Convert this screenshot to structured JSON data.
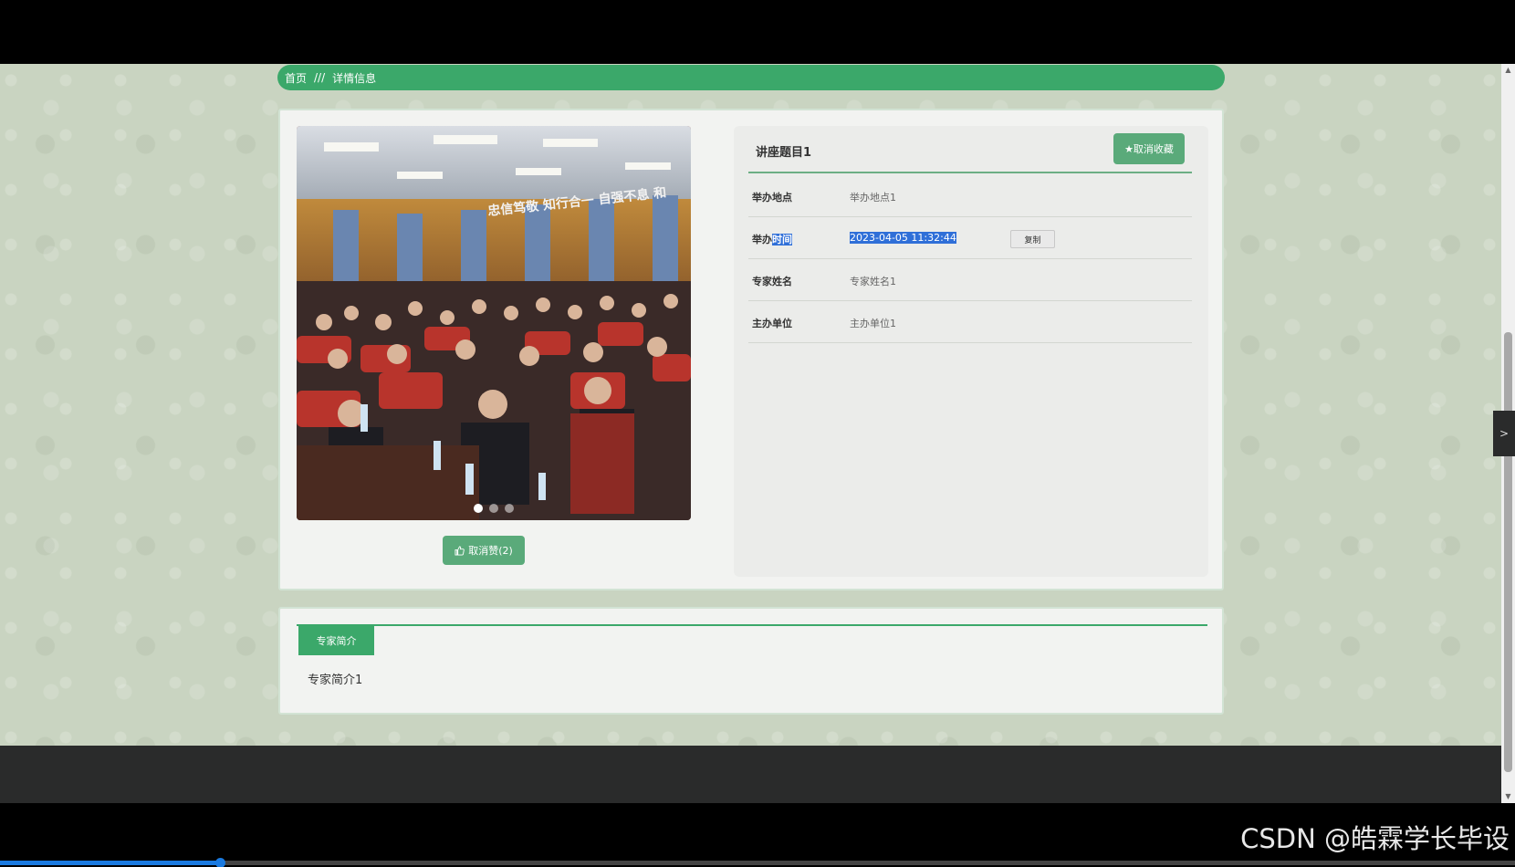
{
  "breadcrumb": {
    "home": "首页",
    "separator": "///",
    "current": "详情信息"
  },
  "lecture": {
    "title": "讲座题目1",
    "unfavorite_label": "★取消收藏",
    "like_label": "取消赞(2)",
    "fields": [
      {
        "label": "举办地点",
        "value": "举办地点1"
      },
      {
        "label_prefix": "举办",
        "label_selected": "时间",
        "value": "2023-04-05 11:32:44",
        "copy_label": "复制"
      },
      {
        "label": "专家姓名",
        "value": "专家姓名1"
      },
      {
        "label": "主办单位",
        "value": "主办单位1"
      }
    ]
  },
  "carousel": {
    "slide_count": 3,
    "active_index": 0,
    "banner_text": "忠信笃敬 知行合一 自强不息 和"
  },
  "bio": {
    "tab_label": "专家简介",
    "text": "专家简介1"
  },
  "video": {
    "watermark": "CSDN @皓霖学长毕设",
    "progress_fraction": 0.145
  },
  "icons": {
    "like": "thumbs-up-icon",
    "scroll_up": "triangle-up-icon",
    "scroll_down": "triangle-down-icon",
    "side_toggle": "chevron-right-icon"
  },
  "colors": {
    "accent": "#3ba86a",
    "button": "#5aaa7a",
    "selection": "#2f6fd8",
    "footer": "#2a2b2b"
  }
}
